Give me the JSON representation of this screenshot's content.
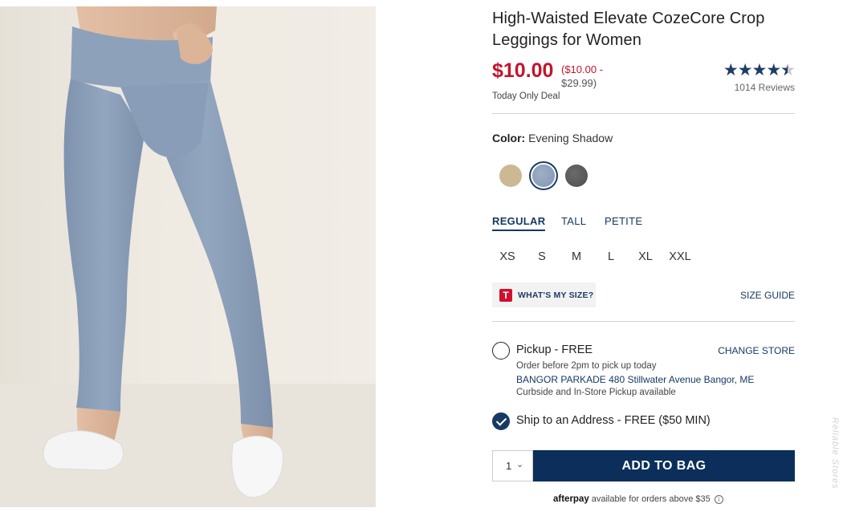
{
  "product": {
    "title": "High-Waisted Elevate CozeCore Crop Leggings for Women",
    "price": "$10.00",
    "price_range_first": "($10.00 -",
    "price_range_second": "$29.99)",
    "deal_label": "Today Only Deal",
    "rating": 4.5,
    "rating_max": 5,
    "reviews": "1014 Reviews"
  },
  "color": {
    "label": "Color:",
    "selected_name": "Evening Shadow",
    "swatches": [
      {
        "name": "Tan",
        "hex": "#cdb894"
      },
      {
        "name": "Evening Shadow",
        "hex": "#8a9db9"
      },
      {
        "name": "Charcoal",
        "hex": "#5b5b5b"
      }
    ]
  },
  "fit_tabs": [
    "REGULAR",
    "TALL",
    "PETITE"
  ],
  "sizes": [
    "XS",
    "S",
    "M",
    "L",
    "XL",
    "XXL"
  ],
  "size_help": {
    "logo_letter": "T",
    "whats_my_size": "WHAT'S MY SIZE?",
    "size_guide": "SIZE GUIDE"
  },
  "fulfillment": {
    "pickup_label": "Pickup - FREE",
    "pickup_note": "Order before 2pm to pick up today",
    "store": "BANGOR PARKADE 480 Stillwater Avenue  Bangor, ME",
    "pickup_availability": "Curbside and In-Store Pickup available",
    "change_store": "CHANGE STORE",
    "ship_label": "Ship to an Address - FREE ($50 MIN)"
  },
  "cart": {
    "quantity": "1",
    "add_to_bag": "ADD TO BAG"
  },
  "afterpay": {
    "logo": "afterpay",
    "text": "available for orders above $35",
    "info_icon": "i"
  },
  "watermark": "Reliable Stores"
}
